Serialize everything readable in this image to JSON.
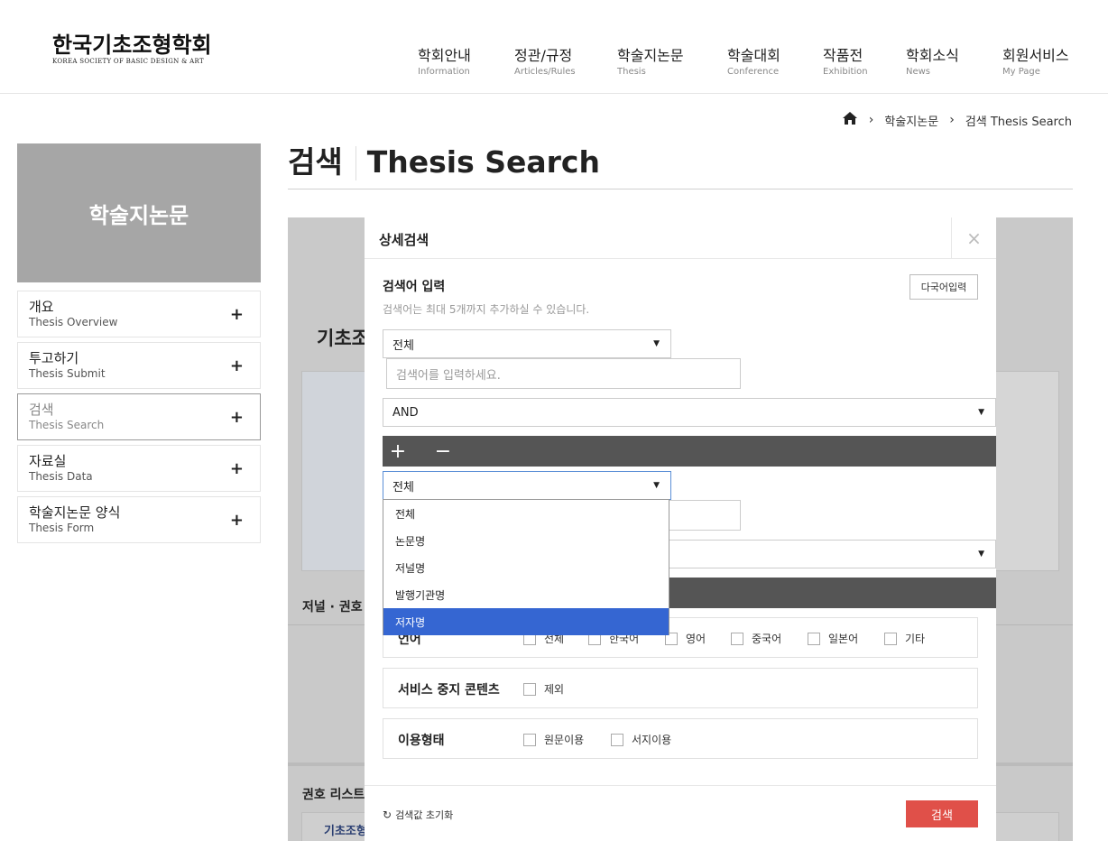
{
  "logo": {
    "ko": "한국기초조형학회",
    "en": "KOREA SOCIETY OF BASIC DESIGN & ART"
  },
  "gnb": [
    {
      "ko": "학회안내",
      "en": "Information"
    },
    {
      "ko": "정관/규정",
      "en": "Articles/Rules"
    },
    {
      "ko": "학술지논문",
      "en": "Thesis"
    },
    {
      "ko": "학술대회",
      "en": "Conference"
    },
    {
      "ko": "작품전",
      "en": "Exhibition"
    },
    {
      "ko": "학회소식",
      "en": "News"
    },
    {
      "ko": "회원서비스",
      "en": "My Page"
    }
  ],
  "breadcrumb": {
    "home_icon": "home-icon",
    "sep": "›",
    "level1": "학술지논문",
    "level2": "검색 Thesis Search"
  },
  "sidebar": {
    "title": "학술지논문",
    "items": [
      {
        "ko": "개요",
        "en": "Thesis Overview"
      },
      {
        "ko": "투고하기",
        "en": "Thesis Submit"
      },
      {
        "ko": "검색",
        "en": "Thesis Search"
      },
      {
        "ko": "자료실",
        "en": "Thesis Data"
      },
      {
        "ko": "학술지논문 양식",
        "en": "Thesis Form"
      }
    ],
    "plus": "+"
  },
  "page_title": {
    "ko": "검색",
    "en": "Thesis Search"
  },
  "background": {
    "heading1": "기초조",
    "heading2": "저널 · 권호",
    "heading3": "권호 리스트",
    "tab": "기초조형"
  },
  "modal": {
    "title": "상세검색",
    "close": "×",
    "section_title": "검색어 입력",
    "section_desc": "검색어는 최대 5개까지 추가하실 수 있습니다.",
    "multilang_button": "다국어입력",
    "row1": {
      "field": "전체",
      "placeholder": "검색어를 입력하세요."
    },
    "operator": "AND",
    "add": "+",
    "remove": "−",
    "row2": {
      "field": "전체"
    },
    "arrow": "▼",
    "dropdown_options": [
      "전체",
      "논문명",
      "저널명",
      "발행기관명",
      "저자명"
    ],
    "dropdown_selected_index": 4,
    "filters": {
      "language": {
        "label": "언어",
        "options": [
          "전체",
          "한국어",
          "영어",
          "중국어",
          "일본어",
          "기타"
        ]
      },
      "service": {
        "label": "서비스 중지 콘텐츠",
        "options": [
          "제외"
        ]
      },
      "usage": {
        "label": "이용형태",
        "options": [
          "원문이용",
          "서지이용"
        ]
      }
    },
    "reset_label": "검색값 초기화",
    "reset_icon": "↻",
    "search_button": "검색"
  },
  "colors": {
    "accent_red": "#e05049",
    "dropdown_selected": "#3566d2",
    "toolbar": "#555555",
    "sidebar_title_bg": "#a6a6a6"
  }
}
